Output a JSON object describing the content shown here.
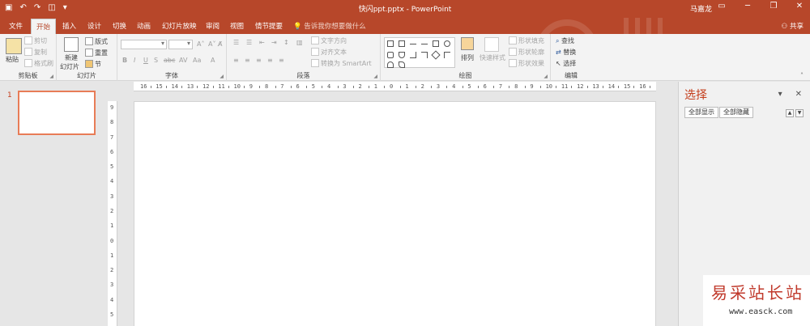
{
  "titlebar": {
    "title": "快闪ppt.pptx  -  PowerPoint",
    "user": "马嘉龙",
    "qat": [
      "save-icon",
      "undo-icon",
      "redo-icon",
      "start-from-beginning-icon",
      "customize-icon"
    ],
    "win": [
      "ribbon-display-icon",
      "minimize-icon",
      "restore-icon",
      "close-icon"
    ]
  },
  "tabs": [
    {
      "label": "文件"
    },
    {
      "label": "开始"
    },
    {
      "label": "插入"
    },
    {
      "label": "设计"
    },
    {
      "label": "切换"
    },
    {
      "label": "动画"
    },
    {
      "label": "幻灯片放映"
    },
    {
      "label": "审阅"
    },
    {
      "label": "视图"
    },
    {
      "label": "情节提要"
    }
  ],
  "tellme": "告诉我你想要做什么",
  "share": "共享",
  "ribbon": {
    "clipboard": {
      "label": "剪贴板",
      "paste": "粘贴",
      "cut": "剪切",
      "copy": "复制",
      "painter": "格式刷"
    },
    "slides": {
      "label": "幻灯片",
      "new_slide_1": "新建",
      "new_slide_2": "幻灯片",
      "layout": "版式",
      "reset": "重置",
      "section": "节"
    },
    "font": {
      "label": "字体"
    },
    "paragraph": {
      "label": "段落",
      "text_direction": "文字方向",
      "align_text": "对齐文本",
      "smartart": "转换为 SmartArt"
    },
    "drawing": {
      "label": "绘图",
      "arrange": "排列",
      "quick_styles": "快速样式",
      "shape_fill": "形状填充",
      "shape_outline": "形状轮廓",
      "shape_effects": "形状效果"
    },
    "editing": {
      "label": "编辑",
      "find": "查找",
      "replace": "替换",
      "select": "选择"
    }
  },
  "ruler": {
    "h": [
      "16",
      "15",
      "14",
      "13",
      "12",
      "11",
      "10",
      "9",
      "8",
      "7",
      "6",
      "5",
      "4",
      "3",
      "2",
      "1",
      "0",
      "1",
      "2",
      "3",
      "4",
      "5",
      "6",
      "7",
      "8",
      "9",
      "10",
      "11",
      "12",
      "13",
      "14",
      "15",
      "16"
    ],
    "v": [
      "9",
      "8",
      "7",
      "6",
      "5",
      "4",
      "3",
      "2",
      "1",
      "0",
      "1",
      "2",
      "3",
      "4",
      "5"
    ]
  },
  "thumbnails": {
    "slide_number": "1"
  },
  "selection_pane": {
    "title": "选择",
    "show_all": "全部显示",
    "hide_all": "全部隐藏"
  },
  "watermark": {
    "cn": "易采站长站",
    "url": "www.easck.com"
  }
}
